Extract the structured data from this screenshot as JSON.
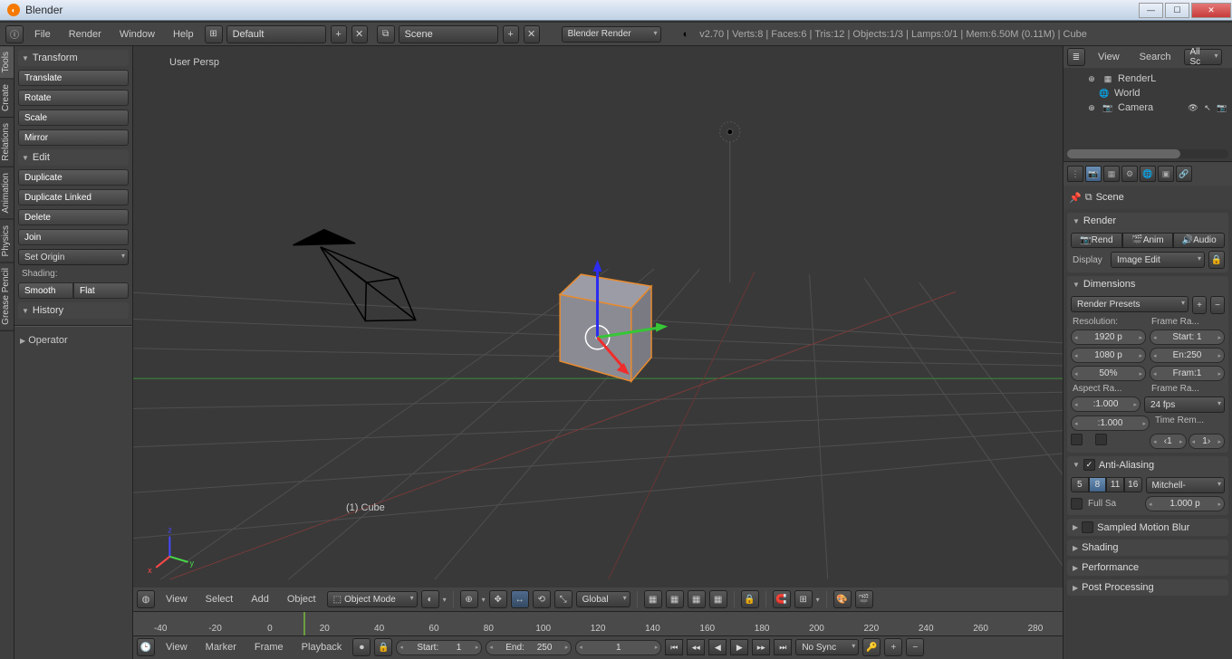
{
  "window": {
    "title": "Blender"
  },
  "info_bar": {
    "file": "File",
    "render": "Render",
    "window_menu": "Window",
    "help": "Help",
    "layout": "Default",
    "scene": "Scene",
    "engine": "Blender Render",
    "stats": "v2.70 | Verts:8 | Faces:6 | Tris:12 | Objects:1/3 | Lamps:0/1 | Mem:6.50M (0.11M) | Cube"
  },
  "tool_shelf": {
    "tabs": [
      "Tools",
      "Create",
      "Relations",
      "Animation",
      "Physics",
      "Grease Pencil"
    ],
    "panel_transform": "Transform",
    "translate": "Translate",
    "rotate": "Rotate",
    "scale": "Scale",
    "mirror": "Mirror",
    "panel_edit": "Edit",
    "duplicate": "Duplicate",
    "duplicate_linked": "Duplicate Linked",
    "delete": "Delete",
    "join": "Join",
    "set_origin": "Set Origin",
    "shading": "Shading:",
    "smooth": "Smooth",
    "flat": "Flat",
    "panel_history": "History",
    "operator": "Operator"
  },
  "viewport": {
    "overlay": "User Persp",
    "object_label": "(1) Cube",
    "view": "View",
    "select": "Select",
    "add": "Add",
    "object": "Object",
    "mode": "Object Mode",
    "orientation": "Global"
  },
  "timeline": {
    "frames": [
      "-40",
      "-20",
      "0",
      "20",
      "40",
      "60",
      "80",
      "100",
      "120",
      "140",
      "160",
      "180",
      "200",
      "220",
      "240",
      "260",
      "280"
    ],
    "view": "View",
    "marker": "Marker",
    "frame": "Frame",
    "playback": "Playback",
    "start_label": "Start:",
    "start": "1",
    "end_label": "End:",
    "end": "250",
    "current": "1",
    "sync": "No Sync"
  },
  "outliner": {
    "view": "View",
    "search": "Search",
    "filter": "All Sc",
    "items": [
      "RenderL",
      "World",
      "Camera"
    ]
  },
  "properties": {
    "scene": "Scene",
    "render": {
      "title": "Render",
      "render_btn": "Rend",
      "anim_btn": "Anim",
      "audio_btn": "Audio",
      "display": "Display",
      "display_drop": "Image Edit"
    },
    "dimensions": {
      "title": "Dimensions",
      "presets": "Render Presets",
      "resolution": "Resolution:",
      "frame_range": "Frame Ra...",
      "res_x": "1920 p",
      "res_y": "1080 p",
      "res_pct": "50%",
      "start": "Start: 1",
      "end": "En:250",
      "step": "Fram:1",
      "aspect": "Aspect Ra...",
      "frame_rate": "Frame Ra...",
      "aspect_x": ":1.000",
      "aspect_y": ":1.000",
      "fps": "24 fps",
      "time_remap": "Time Rem...",
      "tr_a": "‹1",
      "tr_b": "1›"
    },
    "aa": {
      "title": "Anti-Aliasing",
      "s5": "5",
      "s8": "8",
      "s11": "11",
      "s16": "16",
      "filter": "Mitchell-",
      "full": "Full Sa",
      "px": "1.000 p"
    },
    "motion_blur": "Sampled Motion Blur",
    "shading": "Shading",
    "performance": "Performance",
    "post": "Post Processing"
  }
}
